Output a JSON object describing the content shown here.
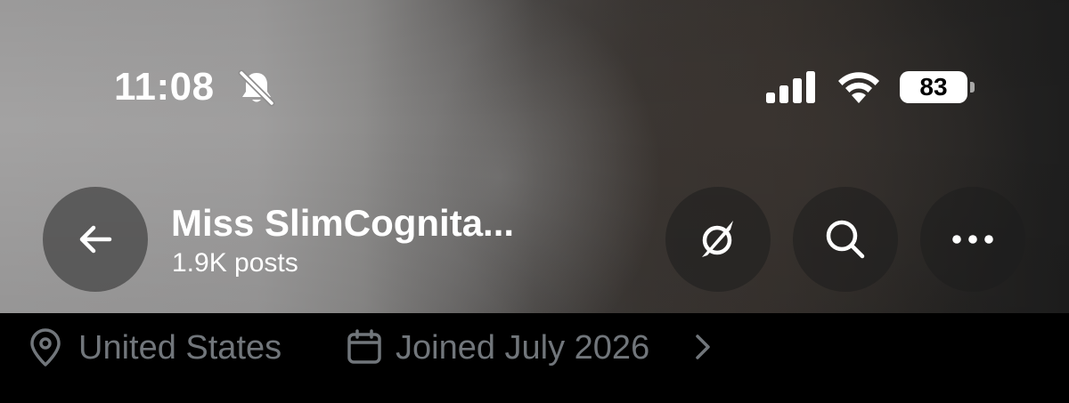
{
  "status_bar": {
    "time": "11:08",
    "silent_icon": "bell-slash-icon",
    "signal_icon": "cellular-signal-icon",
    "wifi_icon": "wifi-icon",
    "battery_level": "83"
  },
  "header": {
    "back_icon": "arrow-left-icon",
    "profile_name": "Miss SlimCognita...",
    "post_count": "1.9K posts",
    "actions": [
      {
        "name": "grok-button",
        "icon": "grok-icon"
      },
      {
        "name": "search-button",
        "icon": "search-icon"
      },
      {
        "name": "more-button",
        "icon": "more-horizontal-icon"
      }
    ]
  },
  "profile_info": {
    "location_icon": "location-pin-icon",
    "location": "United States",
    "joined_icon": "calendar-icon",
    "joined": "Joined July 2026",
    "chevron_icon": "chevron-right-icon"
  },
  "colors": {
    "text_primary": "#ffffff",
    "text_secondary": "#71767b",
    "background": "#000000",
    "button_bg": "#1e1e1e"
  }
}
